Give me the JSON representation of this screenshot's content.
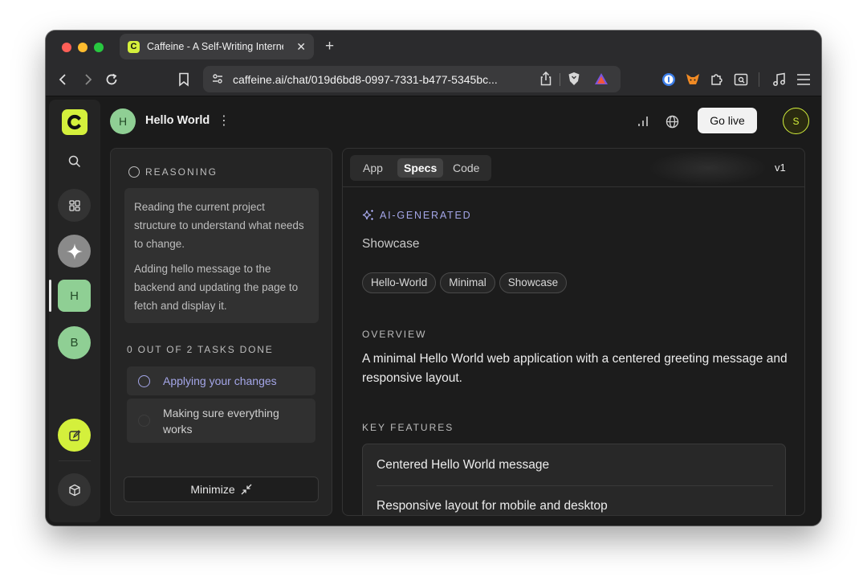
{
  "browser": {
    "tab_title": "Caffeine - A Self-Writing Internet",
    "tab_favicon": "C",
    "new_tab": "+",
    "close_tab": "✕",
    "url": "caffeine.ai/chat/019d6bd8-0997-7331-b477-5345bc..."
  },
  "sidebar": {
    "logo": "C",
    "projects": [
      {
        "initial": "H",
        "color": "#8fcf94"
      },
      {
        "initial": "B",
        "color": "#8fcf94"
      }
    ]
  },
  "header": {
    "project_initial": "H",
    "project_name": "Hello World",
    "menu": "⋮",
    "go_live": "Go live",
    "user_initial": "S"
  },
  "reasoning": {
    "label": "REASONING",
    "paragraphs": [
      "Reading the current project structure to understand what needs to change.",
      "Adding hello message to the backend and updating the page to fetch and display it."
    ]
  },
  "tasks": {
    "label": "0 OUT OF 2 TASKS DONE",
    "items": [
      {
        "text": "Applying your changes",
        "status": "active"
      },
      {
        "text": "Making sure everything works",
        "status": "pending"
      }
    ],
    "minimize": "Minimize"
  },
  "specs": {
    "tabs": [
      {
        "label": "App",
        "active": false
      },
      {
        "label": "Specs",
        "active": true
      },
      {
        "label": "Code",
        "active": false
      }
    ],
    "version": "v1",
    "ai_label": "AI-GENERATED",
    "category": "Showcase",
    "tags": [
      "Hello-World",
      "Minimal",
      "Showcase"
    ],
    "overview_label": "OVERVIEW",
    "overview": "A minimal Hello World web application with a centered greeting message and responsive layout.",
    "features_label": "KEY FEATURES",
    "features": [
      "Centered Hello World message",
      "Responsive layout for mobile and desktop"
    ]
  },
  "colors": {
    "accent": "#d4f03c",
    "ai_purple": "#a4a6e8",
    "task_active": "#a4a6e8"
  }
}
